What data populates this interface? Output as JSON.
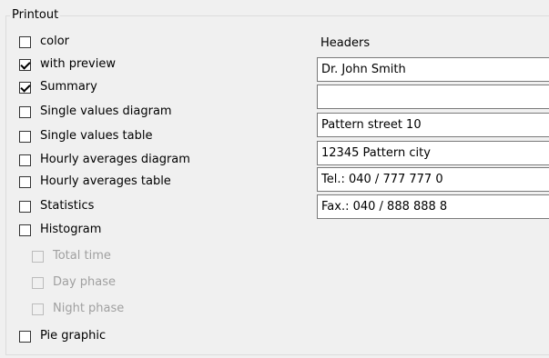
{
  "group": {
    "title": "Printout"
  },
  "options": [
    {
      "label": "color",
      "checked": false,
      "enabled": true
    },
    {
      "label": "with preview",
      "checked": true,
      "enabled": true
    },
    {
      "label": "Summary",
      "checked": true,
      "enabled": true
    },
    {
      "label": "Single values diagram",
      "checked": false,
      "enabled": true
    },
    {
      "label": "Single values table",
      "checked": false,
      "enabled": true
    },
    {
      "label": "Hourly averages diagram",
      "checked": false,
      "enabled": true
    },
    {
      "label": "Hourly averages table",
      "checked": false,
      "enabled": true
    },
    {
      "label": "Statistics",
      "checked": false,
      "enabled": true
    },
    {
      "label": "Histogram",
      "checked": false,
      "enabled": true
    },
    {
      "label": "Total time",
      "checked": false,
      "enabled": false
    },
    {
      "label": "Day phase",
      "checked": false,
      "enabled": false
    },
    {
      "label": "Night phase",
      "checked": false,
      "enabled": false
    },
    {
      "label": "Pie graphic",
      "checked": false,
      "enabled": true
    }
  ],
  "headers": {
    "label": "Headers",
    "fields": [
      {
        "value": "Dr. John Smith"
      },
      {
        "value": ""
      },
      {
        "value": "Pattern street 10"
      },
      {
        "value": "12345 Pattern city"
      },
      {
        "value": "Tel.: 040 / 777 777 0"
      },
      {
        "value": "Fax.: 040 / 888 888 8"
      }
    ]
  }
}
